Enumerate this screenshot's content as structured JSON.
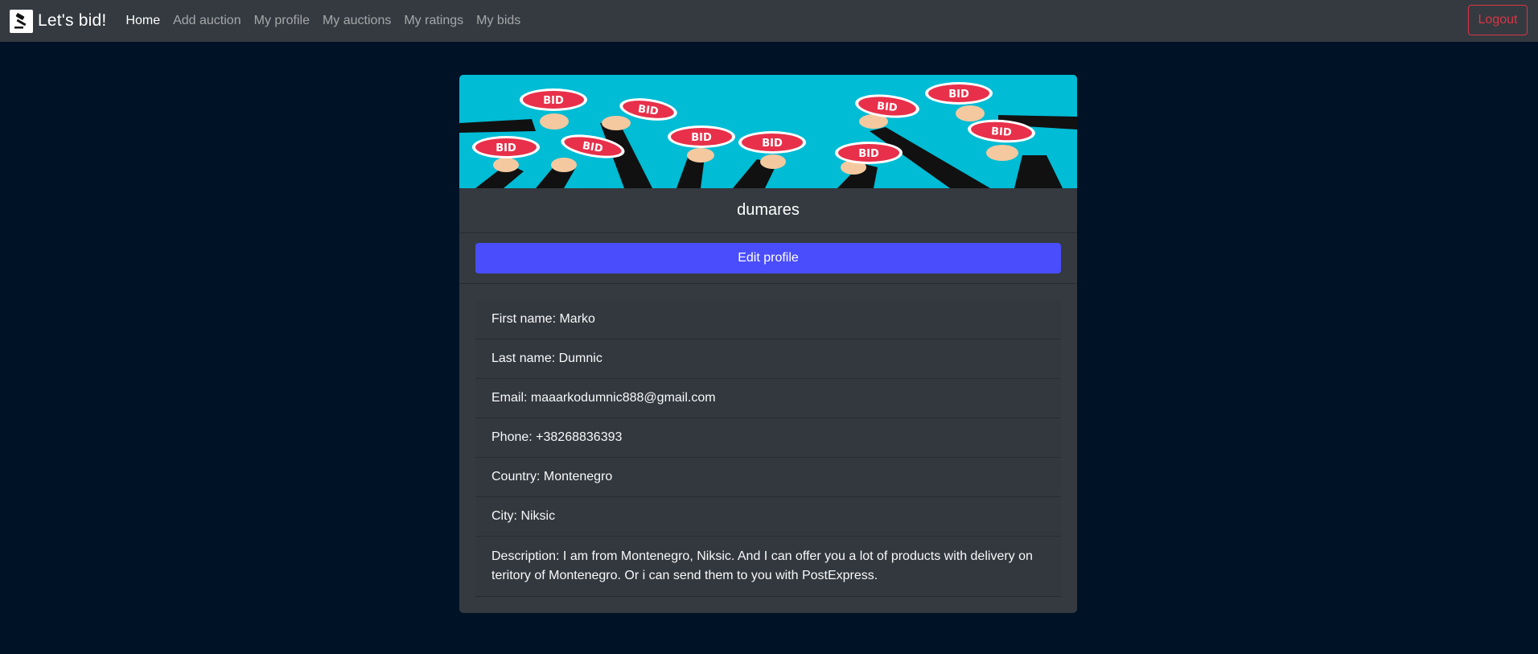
{
  "nav": {
    "brand": "Let's bid!",
    "links": [
      "Home",
      "Add auction",
      "My profile",
      "My auctions",
      "My ratings",
      "My bids"
    ],
    "logout": "Logout"
  },
  "profile": {
    "username": "dumares",
    "edit_label": "Edit profile",
    "banner_sign_text": "BID",
    "fields": {
      "first_name": "First name: Marko",
      "last_name": "Last name: Dumnic",
      "email": "Email: maaarkodumnic888@gmail.com",
      "phone": "Phone: +38268836393",
      "country": "Country: Montenegro",
      "city": "City: Niksic",
      "description": "Description: I am from Montenegro, Niksic. And I can offer you a lot of products with delivery on teritory of Montenegro. Or i can send them to you with PostExpress."
    }
  },
  "colors": {
    "nav_bg": "#343a40",
    "page_bg": "#001226",
    "accent": "#4a4dfc",
    "danger": "#dc3545",
    "banner_bg": "#00bcd4",
    "bid_sign": "#e8304a"
  }
}
